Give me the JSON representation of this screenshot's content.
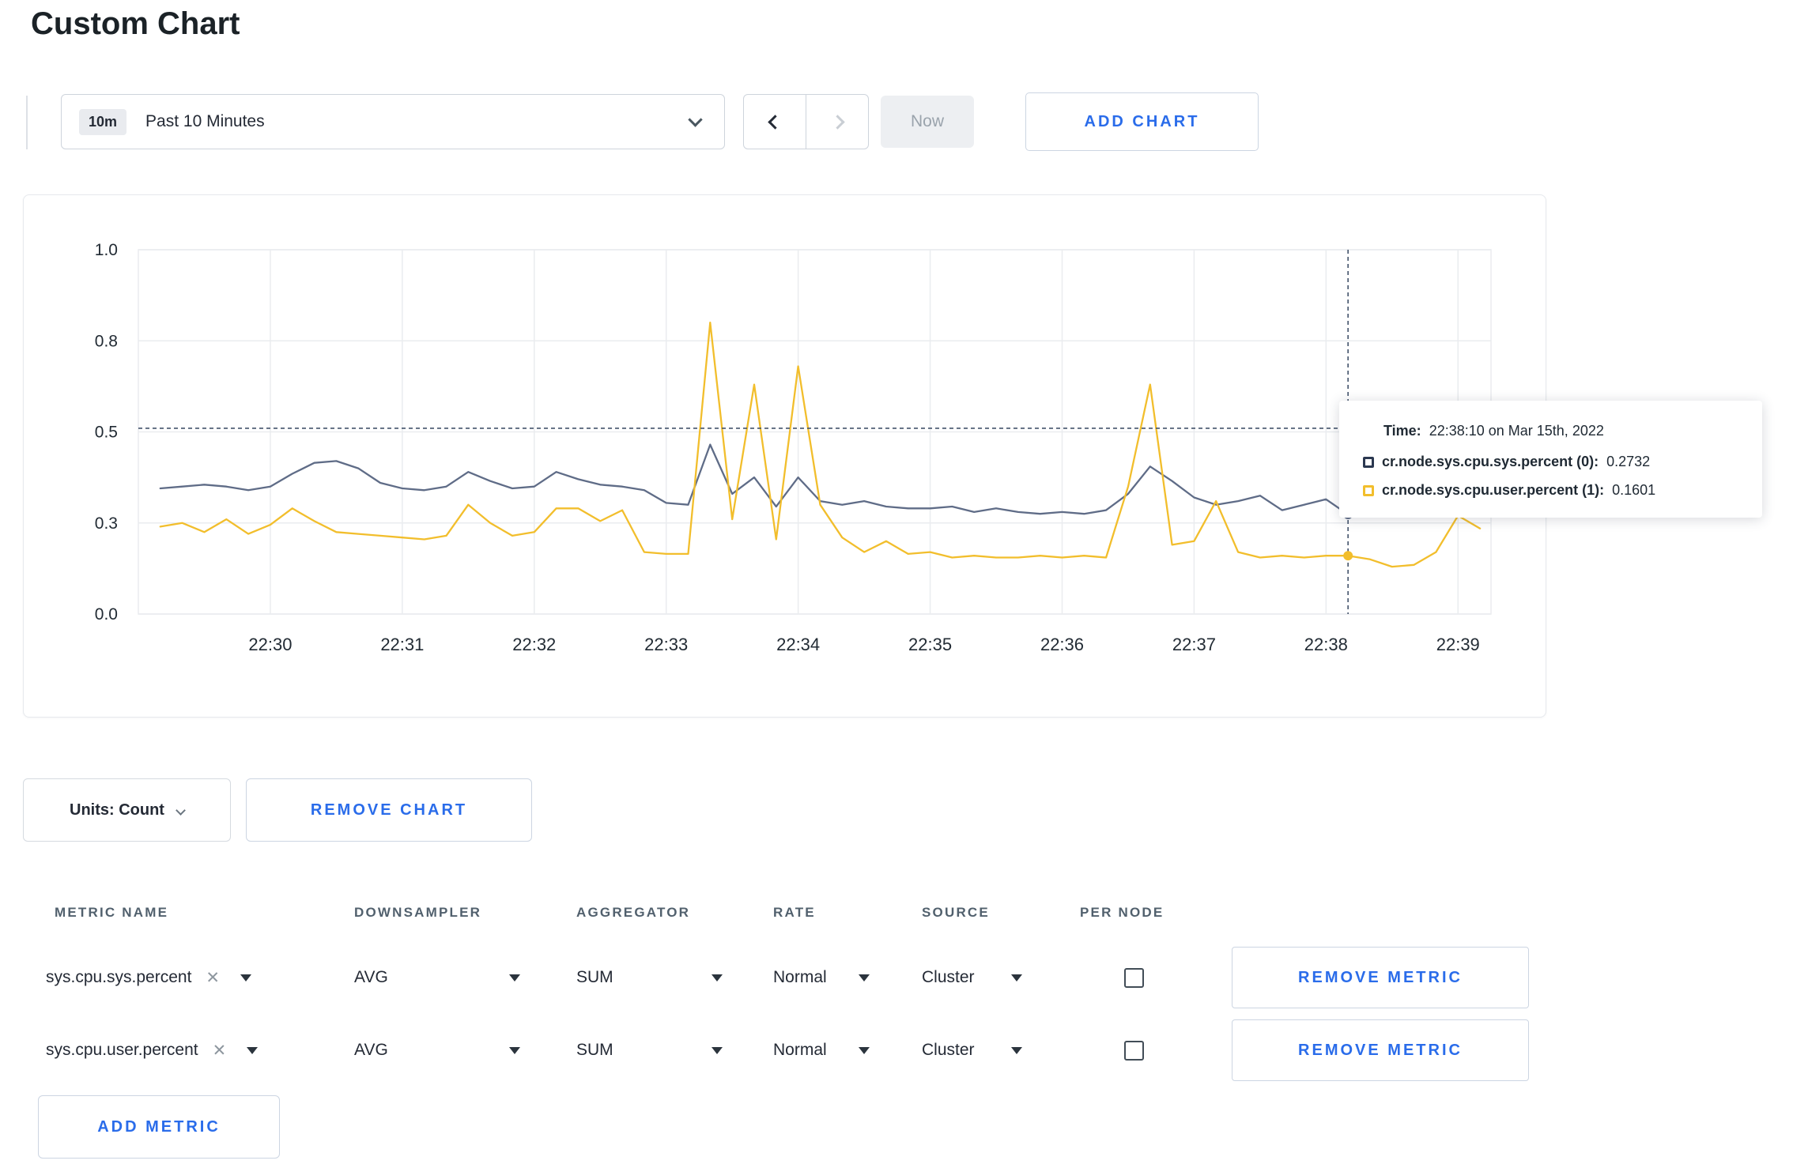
{
  "page": {
    "title": "Custom Chart"
  },
  "toolbar": {
    "time_badge": "10m",
    "time_label": "Past 10 Minutes",
    "now_label": "Now",
    "add_chart_label": "ADD CHART"
  },
  "chart_controls": {
    "units_label": "Units: Count",
    "remove_chart_label": "REMOVE CHART"
  },
  "tooltip": {
    "time_label": "Time:",
    "time_value": "22:38:10 on Mar 15th, 2022",
    "series": [
      {
        "name": "cr.node.sys.cpu.sys.percent (0):",
        "value": "0.2732",
        "color": "#2b3850"
      },
      {
        "name": "cr.node.sys.cpu.user.percent (1):",
        "value": "0.1601",
        "color": "#F2BE2C"
      }
    ]
  },
  "chart_data": {
    "type": "line",
    "title": "",
    "xlabel": "",
    "ylabel": "",
    "grid": true,
    "legend_position": "tooltip",
    "x_axis": {
      "domain_seconds": [
        0,
        615
      ],
      "start_time": "22:29:00",
      "tick_seconds": [
        60,
        120,
        180,
        240,
        300,
        360,
        420,
        480,
        540,
        600
      ],
      "tick_labels": [
        "22:30",
        "22:31",
        "22:32",
        "22:33",
        "22:34",
        "22:35",
        "22:36",
        "22:37",
        "22:38",
        "22:39"
      ]
    },
    "y_axis": {
      "ylim": [
        0,
        1
      ],
      "ticks": [
        0,
        0.25,
        0.5,
        0.75,
        1.0
      ],
      "tick_labels": [
        "0.0",
        "0.3",
        "0.5",
        "0.8",
        "1.0"
      ]
    },
    "x_seconds": [
      10,
      20,
      30,
      40,
      50,
      60,
      70,
      80,
      90,
      100,
      110,
      120,
      130,
      140,
      150,
      160,
      170,
      180,
      190,
      200,
      210,
      220,
      230,
      240,
      250,
      260,
      270,
      280,
      290,
      300,
      310,
      320,
      330,
      340,
      350,
      360,
      370,
      380,
      390,
      400,
      410,
      420,
      430,
      440,
      450,
      460,
      470,
      480,
      490,
      500,
      510,
      520,
      530,
      540,
      550,
      560,
      570,
      580,
      590,
      600,
      610
    ],
    "series": [
      {
        "name": "cr.node.sys.cpu.sys.percent",
        "color": "#5F6C87",
        "values": [
          0.345,
          0.35,
          0.355,
          0.35,
          0.34,
          0.35,
          0.385,
          0.415,
          0.42,
          0.4,
          0.36,
          0.345,
          0.34,
          0.35,
          0.39,
          0.365,
          0.345,
          0.35,
          0.39,
          0.37,
          0.355,
          0.35,
          0.34,
          0.305,
          0.3,
          0.465,
          0.33,
          0.375,
          0.295,
          0.375,
          0.31,
          0.3,
          0.31,
          0.295,
          0.29,
          0.29,
          0.295,
          0.28,
          0.29,
          0.28,
          0.275,
          0.28,
          0.275,
          0.285,
          0.33,
          0.405,
          0.365,
          0.32,
          0.3,
          0.31,
          0.325,
          0.285,
          0.3,
          0.315,
          0.2732,
          0.29,
          0.295,
          0.3,
          0.295,
          0.3,
          0.31
        ]
      },
      {
        "name": "cr.node.sys.cpu.user.percent",
        "color": "#F2BE2C",
        "values": [
          0.24,
          0.25,
          0.225,
          0.26,
          0.22,
          0.245,
          0.29,
          0.255,
          0.225,
          0.22,
          0.215,
          0.21,
          0.205,
          0.215,
          0.3,
          0.25,
          0.215,
          0.225,
          0.29,
          0.29,
          0.255,
          0.285,
          0.17,
          0.165,
          0.165,
          0.8,
          0.26,
          0.63,
          0.205,
          0.68,
          0.3,
          0.21,
          0.17,
          0.2,
          0.165,
          0.17,
          0.155,
          0.16,
          0.155,
          0.155,
          0.16,
          0.155,
          0.16,
          0.155,
          0.35,
          0.63,
          0.19,
          0.2,
          0.31,
          0.17,
          0.155,
          0.16,
          0.155,
          0.16,
          0.1601,
          0.15,
          0.13,
          0.135,
          0.17,
          0.27,
          0.235
        ]
      }
    ],
    "crosshair": {
      "x_seconds": 550,
      "y_value": 0.51,
      "time": "22:38:10"
    },
    "hover_points": [
      {
        "series": 0,
        "x_seconds": 550,
        "value": 0.2732
      },
      {
        "series": 1,
        "x_seconds": 550,
        "value": 0.1601
      }
    ]
  },
  "metrics_table": {
    "headers": [
      "METRIC NAME",
      "DOWNSAMPLER",
      "AGGREGATOR",
      "RATE",
      "SOURCE",
      "PER NODE"
    ],
    "rows": [
      {
        "metric": "sys.cpu.sys.percent",
        "downsampler": "AVG",
        "aggregator": "SUM",
        "rate": "Normal",
        "source": "Cluster",
        "per_node": false,
        "remove_label": "REMOVE METRIC"
      },
      {
        "metric": "sys.cpu.user.percent",
        "downsampler": "AVG",
        "aggregator": "SUM",
        "rate": "Normal",
        "source": "Cluster",
        "per_node": false,
        "remove_label": "REMOVE METRIC"
      }
    ],
    "add_metric_label": "ADD METRIC"
  },
  "colors": {
    "accent_blue": "#2a6cea",
    "series_sys": "#5F6C87",
    "series_user": "#F2BE2C",
    "grid_line": "#eaecef",
    "crosshair": "#43536b"
  }
}
